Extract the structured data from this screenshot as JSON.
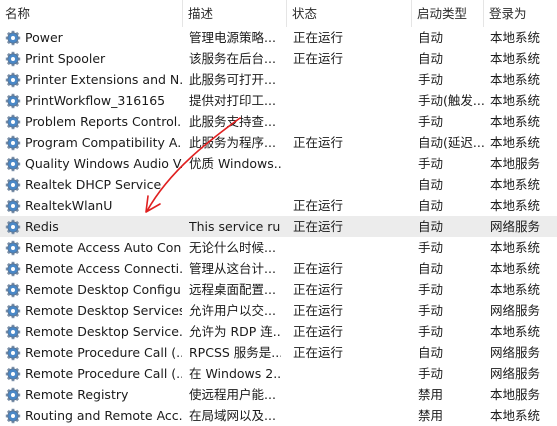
{
  "header": {
    "columns": [
      "名称",
      "描述",
      "状态",
      "启动类型",
      "登录为"
    ],
    "sort_indicator": "^"
  },
  "services": [
    {
      "name": "Power",
      "desc": "管理电源策略...",
      "status": "正在运行",
      "startup": "自动",
      "logon": "本地系统"
    },
    {
      "name": "Print Spooler",
      "desc": "该服务在后台...",
      "status": "正在运行",
      "startup": "自动",
      "logon": "本地系统"
    },
    {
      "name": "Printer Extensions and N...",
      "desc": "此服务可打开...",
      "status": "",
      "startup": "手动",
      "logon": "本地系统"
    },
    {
      "name": "PrintWorkflow_316165",
      "desc": "提供对打印工...",
      "status": "",
      "startup": "手动(触发...",
      "logon": "本地系统"
    },
    {
      "name": "Problem Reports Control...",
      "desc": "此服务支持查...",
      "status": "",
      "startup": "手动",
      "logon": "本地系统"
    },
    {
      "name": "Program Compatibility A...",
      "desc": "此服务为程序...",
      "status": "正在运行",
      "startup": "自动(延迟...",
      "logon": "本地系统"
    },
    {
      "name": "Quality Windows Audio V...",
      "desc": "优质 Windows...",
      "status": "",
      "startup": "手动",
      "logon": "本地服务"
    },
    {
      "name": "Realtek DHCP Service",
      "desc": "",
      "status": "",
      "startup": "自动",
      "logon": "本地系统"
    },
    {
      "name": "RealtekWlanU",
      "desc": "",
      "status": "正在运行",
      "startup": "自动",
      "logon": "本地系统"
    },
    {
      "name": "Redis",
      "desc": "This service ru...",
      "status": "正在运行",
      "startup": "自动",
      "logon": "网络服务",
      "selected": true
    },
    {
      "name": "Remote Access Auto Con...",
      "desc": "无论什么时候...",
      "status": "",
      "startup": "手动",
      "logon": "本地系统"
    },
    {
      "name": "Remote Access Connecti...",
      "desc": "管理从这台计...",
      "status": "正在运行",
      "startup": "自动",
      "logon": "本地系统"
    },
    {
      "name": "Remote Desktop Configu...",
      "desc": "远程桌面配置...",
      "status": "正在运行",
      "startup": "手动",
      "logon": "本地系统"
    },
    {
      "name": "Remote Desktop Services",
      "desc": "允许用户以交...",
      "status": "正在运行",
      "startup": "手动",
      "logon": "网络服务"
    },
    {
      "name": "Remote Desktop Service...",
      "desc": "允许为 RDP 连...",
      "status": "正在运行",
      "startup": "手动",
      "logon": "本地系统"
    },
    {
      "name": "Remote Procedure Call (...",
      "desc": "RPCSS 服务是...",
      "status": "正在运行",
      "startup": "自动",
      "logon": "网络服务"
    },
    {
      "name": "Remote Procedure Call (...",
      "desc": "在 Windows 2...",
      "status": "",
      "startup": "手动",
      "logon": "网络服务"
    },
    {
      "name": "Remote Registry",
      "desc": "使远程用户能...",
      "status": "",
      "startup": "禁用",
      "logon": "本地服务"
    },
    {
      "name": "Routing and Remote Acc...",
      "desc": "在局域网以及...",
      "status": "",
      "startup": "禁用",
      "logon": "本地系统"
    }
  ],
  "colors": {
    "annotation_arrow": "#e02020",
    "selected_row": "#ececec",
    "gear": "#4a88c7"
  },
  "icons": {
    "service": "gear-icon",
    "sort": "chevron-up-icon",
    "annotation": "arrow-annotation"
  }
}
